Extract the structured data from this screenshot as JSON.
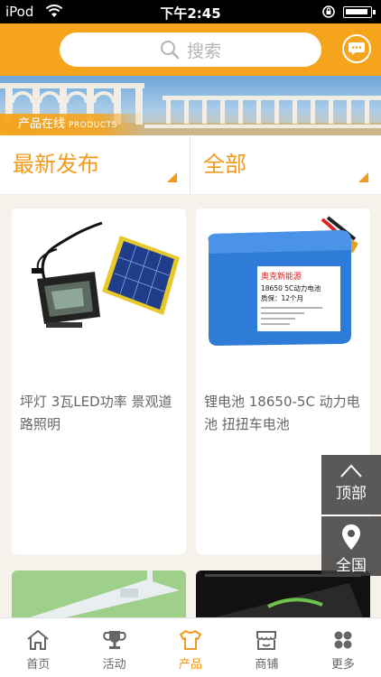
{
  "status": {
    "carrier": "iPod",
    "time": "下午2:45"
  },
  "header": {
    "search_placeholder": "搜索"
  },
  "banner": {
    "caption": "产品在线",
    "caption_en": "PRODUCTS"
  },
  "filters": [
    {
      "label": "最新发布"
    },
    {
      "label": "全部"
    }
  ],
  "products": [
    {
      "name": "坪灯 3瓦LED功率 景观道路照明"
    },
    {
      "name": "锂电池 18650-5C 动力电池 扭扭车电池"
    }
  ],
  "battery_label": {
    "brand": "奥克新能源",
    "model": "18650 5C动力电池",
    "warranty": "质保：12个月"
  },
  "float_buttons": {
    "top": "顶部",
    "all": "全国"
  },
  "tabs": [
    {
      "label": "首页",
      "icon": "home-icon"
    },
    {
      "label": "活动",
      "icon": "trophy-icon"
    },
    {
      "label": "产品",
      "icon": "shirt-icon"
    },
    {
      "label": "商铺",
      "icon": "store-icon"
    },
    {
      "label": "更多",
      "icon": "grid-icon"
    }
  ],
  "colors": {
    "accent": "#f6a41b",
    "accent_text": "#f29a1e"
  }
}
